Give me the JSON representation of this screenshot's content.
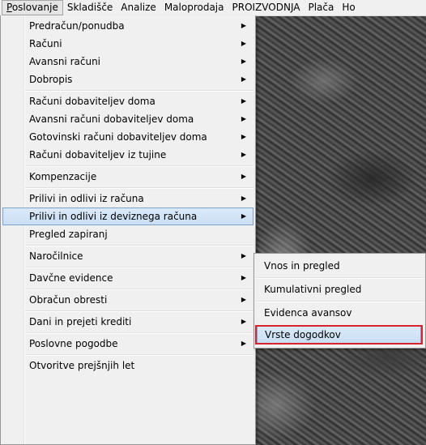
{
  "menubar": {
    "items": [
      {
        "prefix": "P",
        "rest": "oslovanje"
      },
      {
        "label": "Skladišče"
      },
      {
        "label": "Analize"
      },
      {
        "label": "Maloprodaja"
      },
      {
        "label": "PROIZVODNJA"
      },
      {
        "label": "Plača"
      },
      {
        "label": "Ho"
      }
    ]
  },
  "menu": {
    "items": [
      {
        "label": "Predračun/ponudba",
        "submenu": true
      },
      {
        "label": "Računi",
        "submenu": true
      },
      {
        "label": "Avansni računi",
        "submenu": true
      },
      {
        "label": "Dobropis",
        "submenu": true
      },
      {
        "label": "Računi dobaviteljev doma",
        "submenu": true
      },
      {
        "label": "Avansni računi dobaviteljev doma",
        "submenu": true
      },
      {
        "label": "Gotovinski računi dobaviteljev doma",
        "submenu": true
      },
      {
        "label": "Računi dobaviteljev iz tujine",
        "submenu": true
      },
      {
        "label": "Kompenzacije",
        "submenu": true
      },
      {
        "label": "Prilivi in odlivi iz računa",
        "submenu": true
      },
      {
        "label": "Prilivi in odlivi iz deviznega računa",
        "submenu": true,
        "highlighted": true
      },
      {
        "label": "Pregled zapiranj",
        "submenu": false
      },
      {
        "label": "Naročilnice",
        "submenu": true
      },
      {
        "label": "Davčne evidence",
        "submenu": true
      },
      {
        "label": "Obračun obresti",
        "submenu": true
      },
      {
        "label": "Dani in prejeti krediti",
        "submenu": true
      },
      {
        "label": "Poslovne pogodbe",
        "submenu": true
      },
      {
        "label": "Otvoritve prejšnjih let",
        "submenu": false
      }
    ],
    "arrow_glyph": "▶"
  },
  "submenu": {
    "items": [
      {
        "label": "Vnos in pregled"
      },
      {
        "label": "Kumulativni pregled"
      },
      {
        "label": "Evidenca avansov"
      },
      {
        "label": "Vrste dogodkov",
        "highlighted": true
      }
    ]
  }
}
